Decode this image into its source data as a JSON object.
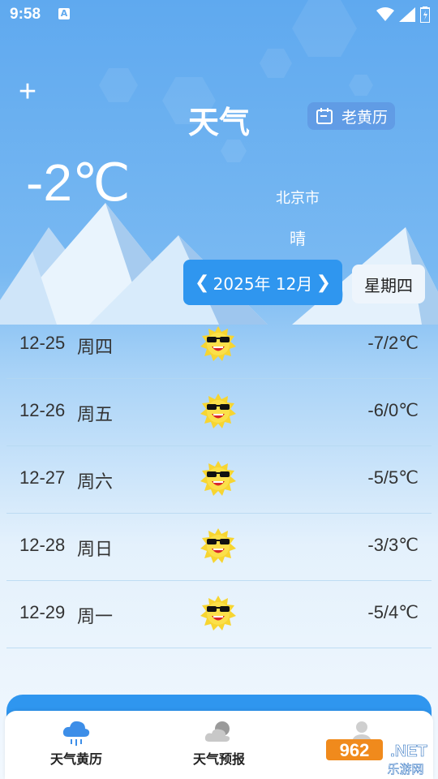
{
  "status_bar": {
    "time": "9:58",
    "notification_badge": "A"
  },
  "header": {
    "title": "天气",
    "add_icon": "plus-icon",
    "almanac_button_label": "老黄历",
    "almanac_icon": "calendar-icon"
  },
  "current": {
    "temperature": "-2℃",
    "city": "北京市",
    "condition": "晴"
  },
  "month_picker": {
    "label": "2025年 12月",
    "prev_icon": "chevron-left-icon",
    "next_icon": "chevron-right-icon"
  },
  "weekday_badge": "星期四",
  "forecast": [
    {
      "date": "12-25",
      "weekday": "周四",
      "icon": "sunny-sunglasses-icon",
      "temp": "-7/2℃"
    },
    {
      "date": "12-26",
      "weekday": "周五",
      "icon": "sunny-sunglasses-icon",
      "temp": "-6/0℃"
    },
    {
      "date": "12-27",
      "weekday": "周六",
      "icon": "sunny-sunglasses-icon",
      "temp": "-5/5℃"
    },
    {
      "date": "12-28",
      "weekday": "周日",
      "icon": "sunny-sunglasses-icon",
      "temp": "-3/3℃"
    },
    {
      "date": "12-29",
      "weekday": "周一",
      "icon": "sunny-sunglasses-icon",
      "temp": "-5/4℃"
    }
  ],
  "bottom_nav": [
    {
      "label": "天气黄历",
      "icon": "rain-cloud-icon",
      "active": true
    },
    {
      "label": "天气预报",
      "icon": "cloudy-icon",
      "active": false
    },
    {
      "label": "",
      "icon": "user-icon",
      "active": false
    }
  ],
  "watermark": {
    "brand": "962.NET",
    "subtitle": "乐游网"
  },
  "colors": {
    "accent": "#2f96ef",
    "sky_top": "#5fa9ef",
    "panel": "#eef5fc"
  }
}
